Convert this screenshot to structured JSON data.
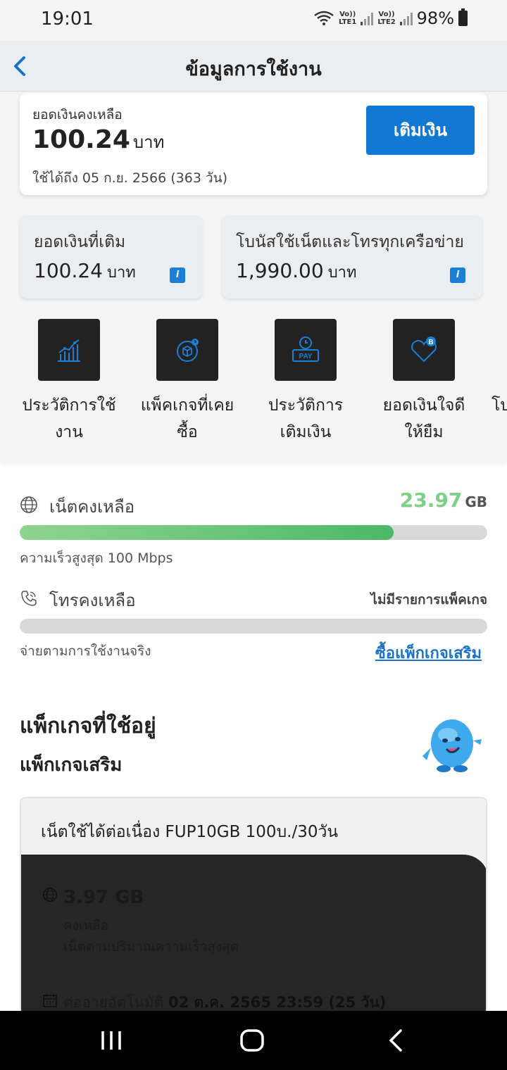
{
  "status_bar": {
    "time": "19:01",
    "sim1_label": "Vo))\nLTE1",
    "sim2_label": "Vo))\nLTE2",
    "battery": "98%"
  },
  "header": {
    "title": "ข้อมูลการใช้งาน",
    "back_icon": "chevron-left-icon"
  },
  "balance": {
    "label": "ยอดเงินคงเหลือ",
    "amount": "100.24",
    "unit": "บาท",
    "valid_until": "ใช้ได้ถึง 05 ก.ย. 2566 (363 วัน)",
    "topup_label": "เติมเงิน",
    "topup_color": "#1178d4"
  },
  "cards": [
    {
      "label": "ยอดเงินที่เติม",
      "value": "100.24",
      "unit": "บาท",
      "icon": "info-icon",
      "icon_glyph": "i"
    },
    {
      "label": "โบนัสใช้เน็ตและโทรทุกเครือข่าย",
      "value": "1,990.00",
      "unit": "บาท",
      "icon": "info-icon",
      "icon_glyph": "i"
    }
  ],
  "shortcuts": [
    {
      "label": "ประวัติการใช้งาน",
      "icon": "usage-chart-icon"
    },
    {
      "label": "แพ็คเกจที่เคยซื้อ",
      "icon": "package-history-icon"
    },
    {
      "label": "ประวัติการเติมเงิน",
      "icon": "pay-history-icon"
    },
    {
      "label": "ยอดเงินใจดีให้ยืม",
      "icon": "heart-loan-icon"
    },
    {
      "label": "โบ",
      "icon": "unknown-icon"
    }
  ],
  "internet": {
    "title": "เน็ตคงเหลือ",
    "remaining": "23.97",
    "unit": "GB",
    "progress_fraction": 0.8,
    "speed_note": "ความเร็วสูงสุด 100 Mbps",
    "accent_color": "#7fd087"
  },
  "voice": {
    "title": "โทรคงเหลือ",
    "status": "ไม่มีรายการแพ็คเกจ",
    "note": "จ่ายตามการใช้งานจริง",
    "buy_link": "ซื้อแพ็กเกจเสริม"
  },
  "packages": {
    "title": "แพ็กเกจที่ใช้อยู่",
    "subtitle": "แพ็กเกจเสริม",
    "item": {
      "name": "เน็ตใช้ได้ต่อเนื่อง FUP10GB  100บ./30วัน",
      "amount": "3.97 GB",
      "remaining_label": "คงเหลือ",
      "description": "เน็ตตามปริมาณความเร็วสูงสุด",
      "renew_label": "ต่ออายุอัตโนมัติ",
      "renew_date": "02 ต.ค. 2565 23:59 (25 วัน)"
    }
  },
  "nav": {
    "recents_icon": "recents-icon",
    "home_icon": "home-icon",
    "back_icon": "back-icon"
  }
}
